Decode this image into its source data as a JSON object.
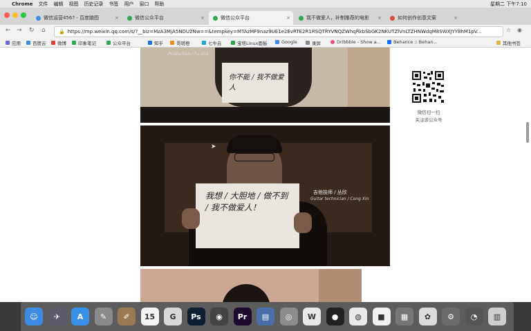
{
  "menubar": {
    "app": "Chrome",
    "items": [
      "文件",
      "编辑",
      "视图",
      "历史记录",
      "书签",
      "用户",
      "窗口",
      "帮助"
    ],
    "clock": "星期二 下午7:10"
  },
  "tabs": [
    {
      "title": "微信运营456? - 百度脑图"
    },
    {
      "title": "微信公众平台"
    },
    {
      "title": "微信公众平台"
    },
    {
      "title": "我不做爱人，补制推荐的电影"
    },
    {
      "title": "如何创作创意文案"
    }
  ],
  "address": {
    "url": "https://mp.weixin.qq.com/s/?__biz=MzA3MjA5NDU2Nw==&tempkey=MTAzMF9naz9UE1e2EvRTE2R1RSQTRYVNQZWhqRkbSbGK2NKUTZlVnLTZHNWdqM8SWXJYY8hM1pV..."
  },
  "bookmarks": [
    {
      "label": "应用",
      "color": "#6b6bd6"
    },
    {
      "label": "百度云",
      "color": "#3b8de0"
    },
    {
      "label": "微博",
      "color": "#e0413b"
    },
    {
      "label": "印象笔记",
      "color": "#2fa84f"
    },
    {
      "label": "公众平台",
      "color": "#2fa84f"
    },
    {
      "label": "知乎",
      "color": "#1a73e8"
    },
    {
      "label": "哥斑橙",
      "color": "#f08a24"
    },
    {
      "label": "七牛云",
      "color": "#1fa6d9"
    },
    {
      "label": "宝塔Linux面板",
      "color": "#28a745"
    },
    {
      "label": "Google",
      "color": "#4285f4"
    },
    {
      "label": "录屏",
      "color": "#888888"
    },
    {
      "label": "Dribbble - Show a...",
      "color": "#ea4c89"
    },
    {
      "label": "Behance :: Behan...",
      "color": "#1769ff"
    }
  ],
  "bookmarks_other": "其他书签",
  "article": {
    "photo1_caption": "Production / Fu Sha",
    "photo1_sign_text": "你不能 / 我不做爱人",
    "photo2_caption": "吉他技师 / 丛欣",
    "photo2_caption_en": "Guitar technician / Cong Xin",
    "photo2_sign_text": "我想 / 大胆地 / 做不到 / 我不做爱人！"
  },
  "sidebar": {
    "qr_line1": "微信扫一扫",
    "qr_line2": "关注该公众号"
  },
  "dock": [
    {
      "name": "finder",
      "glyph": "☺",
      "color": "#3d8be3"
    },
    {
      "name": "launchpad",
      "glyph": "✈",
      "color": "#5a5a6a"
    },
    {
      "name": "app-store",
      "glyph": "A",
      "color": "#3a8fe6"
    },
    {
      "name": "preview",
      "glyph": "✎",
      "color": "#8a8a8a"
    },
    {
      "name": "brush",
      "glyph": "✐",
      "color": "#9a7a55"
    },
    {
      "name": "calendar",
      "glyph": "15",
      "color": "#f4f4f4"
    },
    {
      "name": "mindnode",
      "glyph": "G",
      "color": "#d8d8d8"
    },
    {
      "name": "photoshop",
      "glyph": "Ps",
      "color": "#0f1e33"
    },
    {
      "name": "chrome",
      "glyph": "◉",
      "color": "#444444"
    },
    {
      "name": "premiere",
      "glyph": "Pr",
      "color": "#1d0a2c"
    },
    {
      "name": "keynote",
      "glyph": "▤",
      "color": "#4a6ea8"
    },
    {
      "name": "safari",
      "glyph": "◎",
      "color": "#8c8c8c"
    },
    {
      "name": "wps",
      "glyph": "W",
      "color": "#e8e8e8"
    },
    {
      "name": "qq",
      "glyph": "●",
      "color": "#222222"
    },
    {
      "name": "wechat",
      "glyph": "◍",
      "color": "#e8e8e8"
    },
    {
      "name": "notes",
      "glyph": "■",
      "color": "#f0f0f0"
    },
    {
      "name": "image-viewer",
      "glyph": "▦",
      "color": "#777777"
    },
    {
      "name": "photos",
      "glyph": "✿",
      "color": "#dcdcdc"
    },
    {
      "name": "system-preferences",
      "glyph": "⚙",
      "color": "#6a6a6a"
    },
    {
      "name": "quicktime",
      "glyph": "◔",
      "color": "#555555"
    },
    {
      "name": "trash",
      "glyph": "▥",
      "color": "#cfcfcf"
    }
  ]
}
